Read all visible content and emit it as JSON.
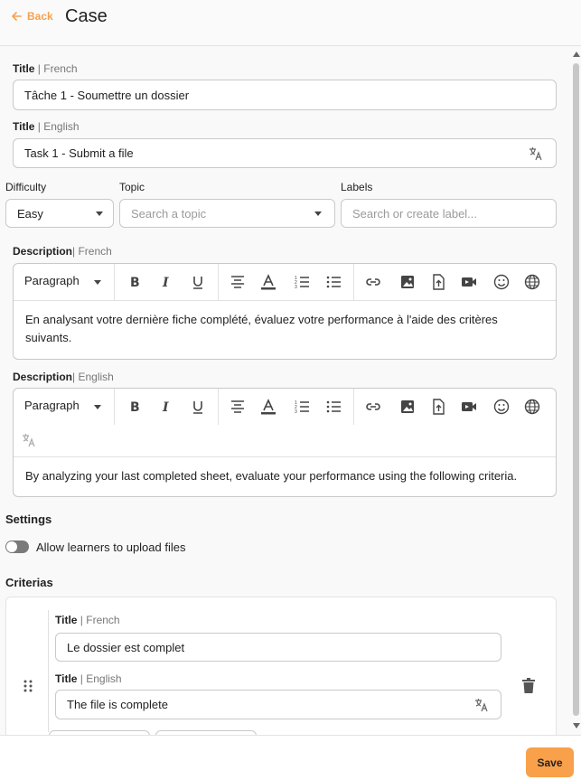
{
  "header": {
    "back_label": "Back",
    "title": "Case"
  },
  "title_fr": {
    "label": "Title",
    "lang": "| French",
    "value": "Tâche 1 - Soumettre un dossier"
  },
  "title_en": {
    "label": "Title",
    "lang": "| English",
    "value": "Task 1 - Submit a file"
  },
  "difficulty": {
    "label": "Difficulty",
    "value": "Easy"
  },
  "topic": {
    "label": "Topic",
    "placeholder": "Search a topic"
  },
  "labels": {
    "label": "Labels",
    "placeholder": "Search or create label..."
  },
  "description_fr": {
    "label": "Description",
    "lang": "| French",
    "format": "Paragraph",
    "text": "En analysant votre dernière fiche complété, évaluez votre performance à l'aide des critères suivants."
  },
  "description_en": {
    "label": "Description",
    "lang": "| English",
    "format": "Paragraph",
    "text": "By analyzing your last completed sheet, evaluate your performance using the following criteria."
  },
  "settings": {
    "title": "Settings",
    "upload_toggle_label": "Allow learners to upload files",
    "upload_enabled": false
  },
  "criterias": {
    "title": "Criterias",
    "items": [
      {
        "title_label": "Title",
        "fr_lang": "| French",
        "fr_value": "Le dossier est complet",
        "en_lang": "| English",
        "en_value": "The file is complete"
      }
    ]
  },
  "toolbar_icons": [
    "bold-icon",
    "italic-icon",
    "underline-icon",
    "align-center-icon",
    "text-color-icon",
    "ordered-list-icon",
    "bullet-list-icon",
    "link-icon",
    "image-icon",
    "file-upload-icon",
    "video-icon",
    "emoji-icon",
    "globe-icon"
  ],
  "footer": {
    "save_label": "Save"
  },
  "colors": {
    "accent": "#f8a04a",
    "back": "#f5a14f"
  }
}
